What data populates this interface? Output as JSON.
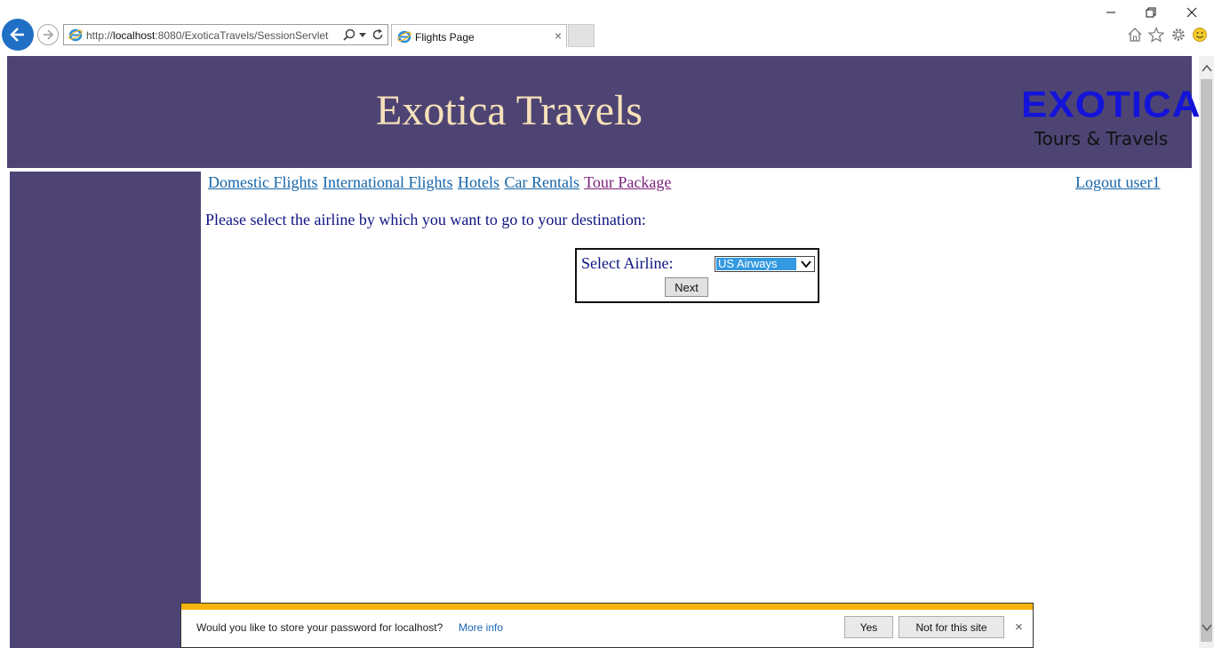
{
  "browser": {
    "url_prefix": "http://",
    "url_host": "localhost",
    "url_rest": ":8080/ExoticaTravels/SessionServlet",
    "tab_title": "Flights Page",
    "tab_close": "×"
  },
  "header": {
    "site_title": "Exotica Travels",
    "logo_word": "EXOTICA",
    "logo_tagline": "Tours & Travels"
  },
  "nav": {
    "links": [
      "Domestic Flights",
      "International Flights",
      "Hotels",
      "Car Rentals",
      "Tour Package"
    ],
    "logout": "Logout user1"
  },
  "main": {
    "prompt": "Please select the airline by which you want to go to your destination:",
    "form": {
      "label": "Select Airline:",
      "selected_airline": "US Airways",
      "next_label": "Next"
    }
  },
  "notification": {
    "message": "Would you like to store your password for localhost?",
    "more_info": "More info",
    "yes_label": "Yes",
    "not_label": "Not for this site",
    "close": "×"
  },
  "colors": {
    "header_bg": "#4e4473",
    "title_color": "#f7e1ba",
    "logo_color": "#1313d9",
    "link_color": "#1565a8",
    "visited_link": "#7a1f7a",
    "text_navy": "#0d1480",
    "notify_stripe": "#f6b40e"
  },
  "icons": [
    "back-arrow-icon",
    "forward-arrow-icon",
    "ie-logo-icon",
    "search-icon",
    "dropdown-icon",
    "refresh-icon",
    "minimize-icon",
    "restore-icon",
    "close-icon",
    "home-icon",
    "favorites-star-icon",
    "settings-gear-icon",
    "smiley-feedback-icon"
  ]
}
